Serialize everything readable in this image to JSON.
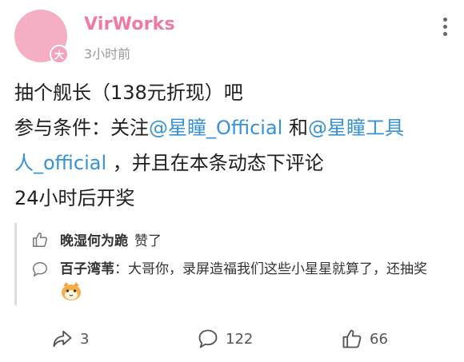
{
  "header": {
    "username": "VirWorks",
    "timestamp": "3小时前",
    "avatar_badge": "大",
    "avatar_color": "#f4afc2",
    "username_color": "#ef7aa0"
  },
  "post": {
    "line1": "抽个舰长（138元折现）吧",
    "line2_prefix": "参与条件：关注",
    "mention1": "@星瞳_Official",
    "line2_mid": " 和",
    "mention2a": "@星瞳工具",
    "mention2b": "人_official",
    "line3_suffix": " ，并且在本条动态下评论",
    "line4": "24小时后开奖",
    "mention_color": "#3592d8"
  },
  "comments": {
    "like_item": {
      "icon": "thumb-up-icon",
      "name": "晚湿何为跪",
      "action": "赞了"
    },
    "reply_item": {
      "icon": "comment-bubble-icon",
      "name": "百子湾苇",
      "separator": "：",
      "text": "大哥你，录屏造福我们这些小星星就算了，还抽奖",
      "emoji": "cat-emoji-icon"
    }
  },
  "actions": {
    "share_count": "3",
    "comment_count": "122",
    "like_count": "66"
  }
}
